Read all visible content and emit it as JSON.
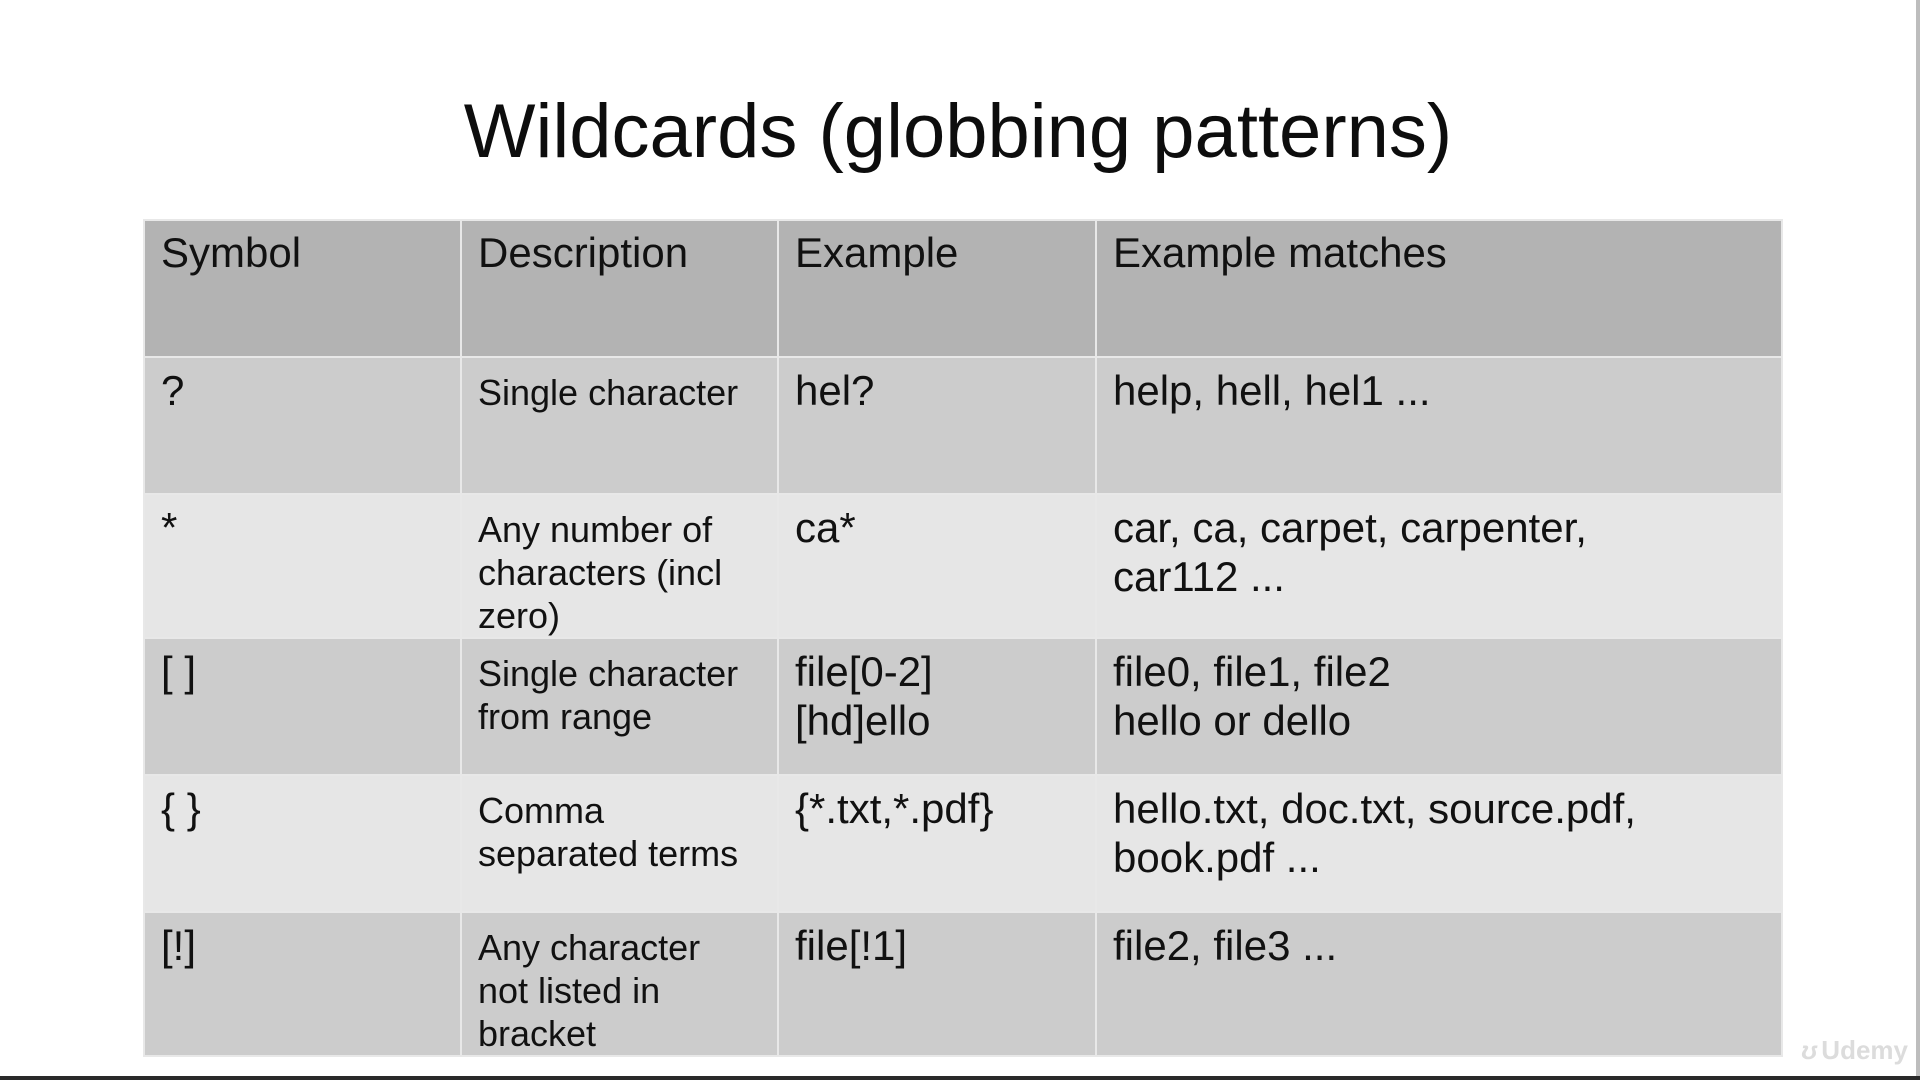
{
  "slide": {
    "title": "Wildcards (globbing patterns)"
  },
  "table": {
    "headers": [
      "Symbol",
      "Description",
      "Example",
      "Example matches"
    ],
    "rows": [
      {
        "symbol": "?",
        "description": [
          "Single character"
        ],
        "example": [
          "hel?"
        ],
        "matches": [
          "help, hell, hel1 ..."
        ]
      },
      {
        "symbol": "*",
        "description": [
          "Any number of",
          "characters (incl",
          "zero)"
        ],
        "example": [
          "ca*"
        ],
        "matches": [
          "car, ca, carpet, carpenter,",
          "car112 ..."
        ]
      },
      {
        "symbol": "[ ]",
        "description": [
          "Single character",
          "from range"
        ],
        "example": [
          "file[0-2]",
          "[hd]ello"
        ],
        "matches": [
          "file0, file1, file2",
          "hello or dello"
        ]
      },
      {
        "symbol": "{ }",
        "description": [
          "Comma",
          "separated terms"
        ],
        "example": [
          "{*.txt,*.pdf}"
        ],
        "matches": [
          "hello.txt, doc.txt, source.pdf,",
          "book.pdf ..."
        ]
      },
      {
        "symbol": "[!]",
        "description": [
          "Any character",
          "not listed in",
          "bracket"
        ],
        "example": [
          "file[!1]"
        ],
        "matches": [
          "file2, file3 ..."
        ]
      }
    ]
  },
  "watermark": {
    "icon": "udemy-logo-icon",
    "text": "Udemy"
  },
  "colors": {
    "header_bg": "#b3b3b3",
    "row_dark": "#cccccc",
    "row_light": "#e6e6e6",
    "grid_line": "#e8e8e8"
  }
}
